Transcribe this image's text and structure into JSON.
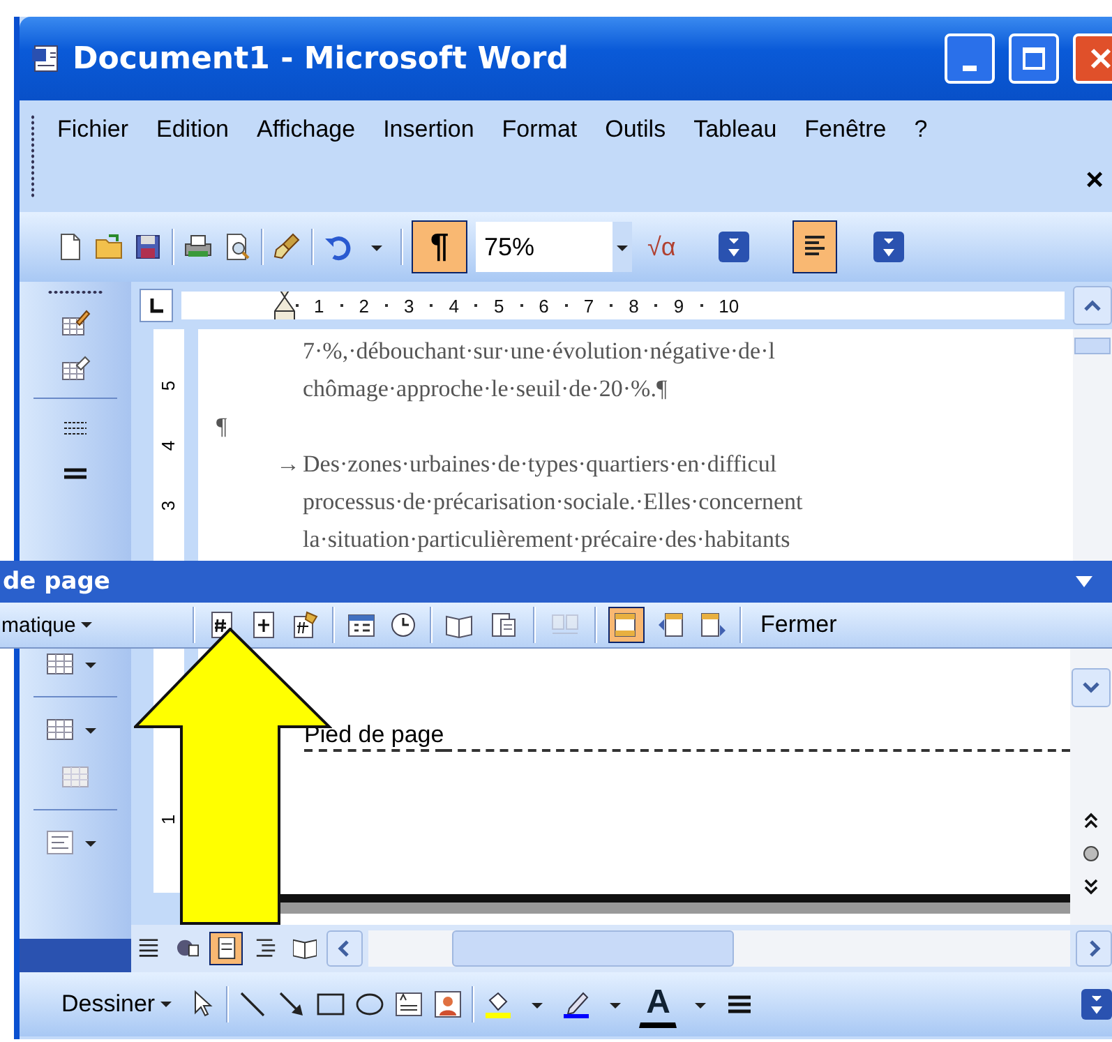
{
  "window": {
    "title": "Document1 - Microsoft Word"
  },
  "menu": {
    "items": [
      {
        "label": "Fichier"
      },
      {
        "label": "Edition"
      },
      {
        "label": "Affichage"
      },
      {
        "label": "Insertion"
      },
      {
        "label": "Format"
      },
      {
        "label": "Outils"
      },
      {
        "label": "Tableau"
      },
      {
        "label": "Fenêtre"
      },
      {
        "label": "?"
      }
    ],
    "close": "×"
  },
  "standard_toolbar": {
    "formatting_marks": {
      "label": "¶",
      "selected": true
    },
    "zoom": "75%",
    "equation": "√α",
    "align_left": {
      "selected": true
    }
  },
  "ruler": {
    "marks": [
      "1",
      "2",
      "3",
      "4",
      "5",
      "6",
      "7",
      "8",
      "9",
      "10"
    ]
  },
  "vertical_ruler": [
    "5",
    "4",
    "3"
  ],
  "document": {
    "lines": [
      {
        "kind": "text",
        "text": "7·%,·débouchant·sur·une·évolution·négative·de·l"
      },
      {
        "kind": "text",
        "text": "chômage·approche·le·seuil·de·20·%.¶"
      },
      {
        "kind": "mark",
        "text": "¶"
      },
      {
        "kind": "text",
        "marker": "→",
        "text": "Des·zones·urbaines·de·types·quartiers·en·difficul"
      },
      {
        "kind": "text",
        "text": "processus·de·précarisation·sociale.·Elles·concernent"
      },
      {
        "kind": "text",
        "text": "la·situation·particulièrement·précaire·des·habitants"
      }
    ]
  },
  "header_footer_toolbar": {
    "title": "de page",
    "insert_menu": "matique",
    "show_document_text": {
      "selected": false
    },
    "same_as_previous": {
      "disabled": true
    },
    "switch_header_footer": {
      "selected": true
    },
    "close": "Fermer"
  },
  "lower_vertical_ruler": [
    "1"
  ],
  "footer": {
    "label": "Pied de page"
  },
  "view_buttons": [
    {
      "selected": false
    },
    {
      "selected": false
    },
    {
      "selected": true
    },
    {
      "selected": false
    },
    {
      "selected": false
    }
  ],
  "drawing_toolbar": {
    "menu": "Dessiner",
    "font_color": "A"
  }
}
